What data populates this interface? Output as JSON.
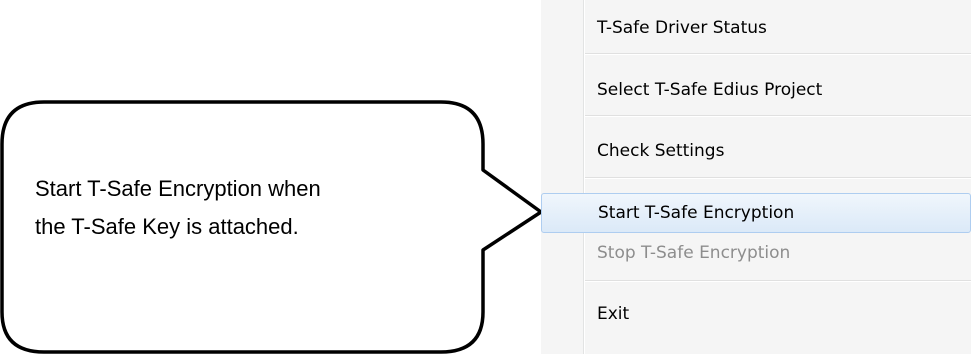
{
  "callout": {
    "line1": "Start T-Safe Encryption when",
    "line2": "the T-Safe Key is attached."
  },
  "menu": {
    "items": [
      {
        "label": "T-Safe Driver Status",
        "state": "normal"
      },
      {
        "label": "Select T-Safe Edius Project",
        "state": "normal"
      },
      {
        "label": "Check Settings",
        "state": "normal"
      },
      {
        "label": "Start T-Safe Encryption",
        "state": "selected"
      },
      {
        "label": "Stop T-Safe Encryption",
        "state": "disabled"
      },
      {
        "label": "Exit",
        "state": "normal"
      }
    ]
  },
  "colors": {
    "menu_background": "#f5f5f5",
    "selected_border": "#aecdf0",
    "disabled_text": "#8d8d8d"
  }
}
